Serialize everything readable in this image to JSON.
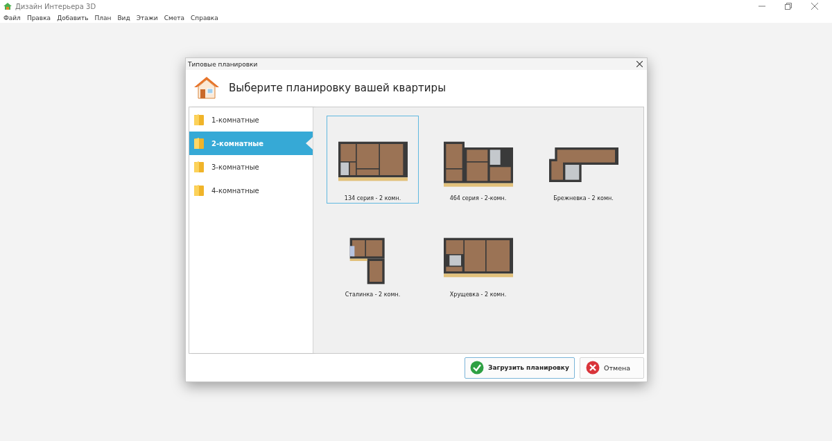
{
  "app": {
    "title": "Дизайн Интерьера 3D"
  },
  "menu": [
    "Файл",
    "Правка",
    "Добавить",
    "План",
    "Вид",
    "Этажи",
    "Смета",
    "Справка"
  ],
  "dialog": {
    "title": "Типовые планировки",
    "heading": "Выберите планировку вашей квартиры",
    "categories": [
      {
        "label": "1-комнатные",
        "selected": false
      },
      {
        "label": "2-комнатные",
        "selected": true
      },
      {
        "label": "3-комнатные",
        "selected": false
      },
      {
        "label": "4-комнатные",
        "selected": false
      }
    ],
    "layouts": [
      {
        "label": "134 серия - 2 комн.",
        "selected": true
      },
      {
        "label": "464 серия - 2-комн.",
        "selected": false
      },
      {
        "label": "Брежневка - 2 комн.",
        "selected": false
      },
      {
        "label": "Сталинка - 2 комн.",
        "selected": false
      },
      {
        "label": "Хрущевка - 2 комн.",
        "selected": false
      }
    ],
    "buttons": [
      {
        "label": "Загрузить планировку",
        "kind": "confirm"
      },
      {
        "label": "Отмена",
        "kind": "cancel"
      }
    ]
  }
}
